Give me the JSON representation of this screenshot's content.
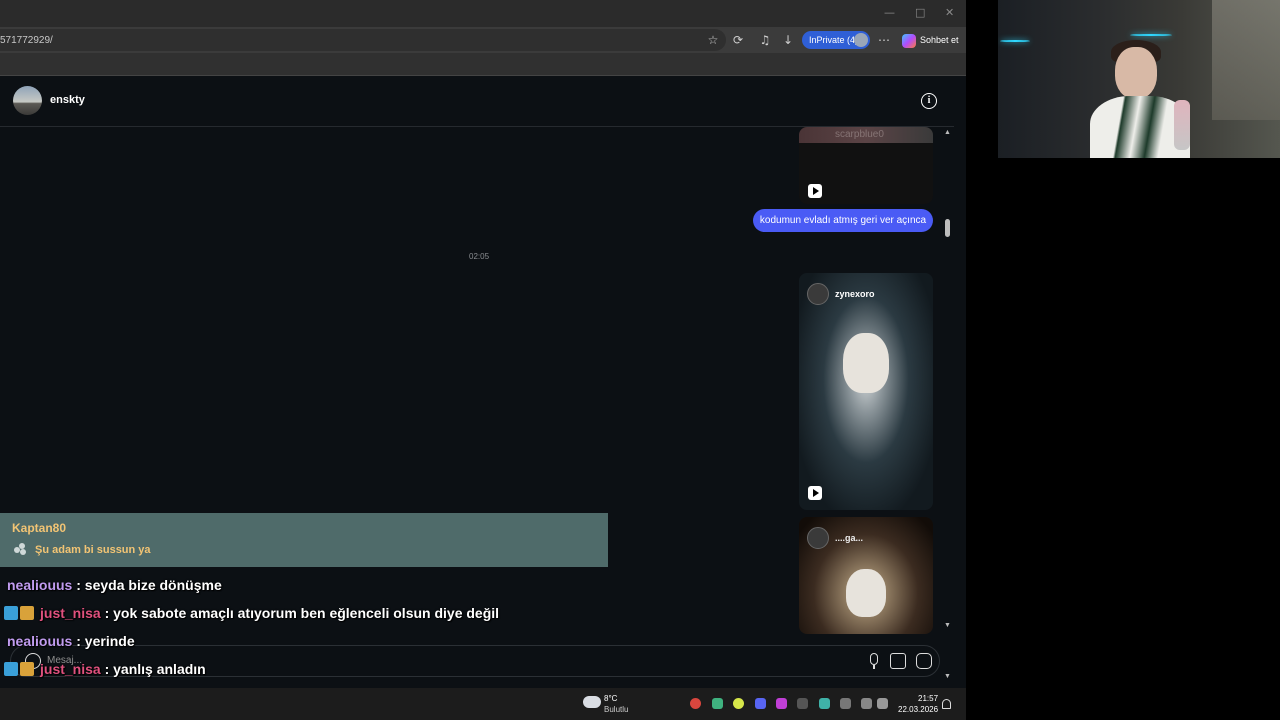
{
  "browser": {
    "url": "571772929/",
    "inprivate_label": "InPrivate (4)",
    "copilot_label": "Sohbet et",
    "window_controls": [
      "—",
      "□",
      "✕"
    ]
  },
  "chat": {
    "username": "enskty",
    "reels": [
      {
        "user": "scarpblue0"
      },
      {
        "user": "zynexoro"
      },
      {
        "user": "....ga..."
      }
    ],
    "sent_message": "kodumun evladı atmış geri ver açınca",
    "timestamp": "02:05",
    "composer_placeholder": "Mesaj..."
  },
  "overlay": {
    "alert": {
      "user": "Kaptan80",
      "message": "Şu adam bi sussun ya"
    },
    "messages": [
      {
        "nick": "nealiouus",
        "text": " : seyda bize dönüşme",
        "nick_color": "#c19cf0",
        "badges": false
      },
      {
        "nick": "just_nisa",
        "text": " : yok sabote amaçlı atıyorum ben eğlenceli olsun diye değil",
        "nick_color": "#e0517e",
        "badges": true
      },
      {
        "nick": "nealiouus",
        "text": " : yerinde",
        "nick_color": "#c19cf0",
        "badges": false
      },
      {
        "nick": "just_nisa",
        "text": " : yanlış anladın",
        "nick_color": "#e0517e",
        "badges": true
      }
    ]
  },
  "taskbar": {
    "weather_temp": "8°C",
    "weather_desc": "Bulutlu",
    "time": "21:57",
    "date": "22.03.2026"
  },
  "colors": {
    "sent_bubble": "#4a5bf5",
    "alert_bg": "#4f6b6a",
    "alert_text": "#f2c474",
    "inprivate_bg": "#2f5fd6"
  }
}
